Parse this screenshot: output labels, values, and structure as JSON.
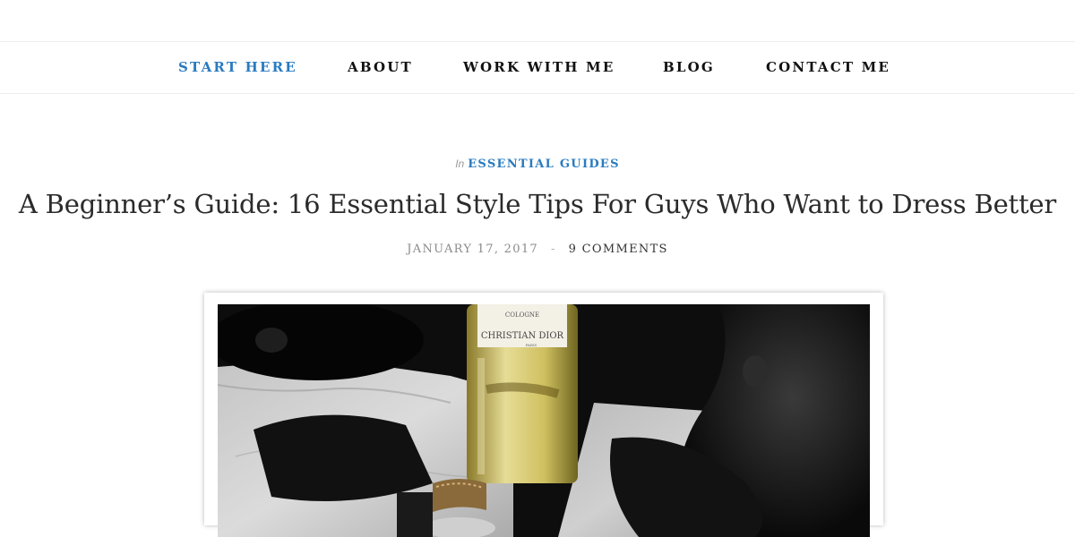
{
  "nav": {
    "items": [
      {
        "label": "START HERE",
        "active": true
      },
      {
        "label": "ABOUT",
        "active": false
      },
      {
        "label": "WORK WITH ME",
        "active": false
      },
      {
        "label": "BLOG",
        "active": false
      },
      {
        "label": "CONTACT ME",
        "active": false
      }
    ]
  },
  "post": {
    "category_prefix": "In",
    "category": "ESSENTIAL GUIDES",
    "title": "A Beginner’s Guide: 16 Essential Style Tips For Guys Who Want to Dress Better",
    "date": "JANUARY 17, 2017",
    "separator": "-",
    "comments": "9 COMMENTS"
  },
  "image": {
    "label_line1": "COLOGNE",
    "label_line2": "CHRISTIAN DIOR",
    "label_line3": "PARIS"
  },
  "colors": {
    "accent": "#2a7bc0",
    "text": "#222222",
    "muted": "#8a8a8a"
  }
}
